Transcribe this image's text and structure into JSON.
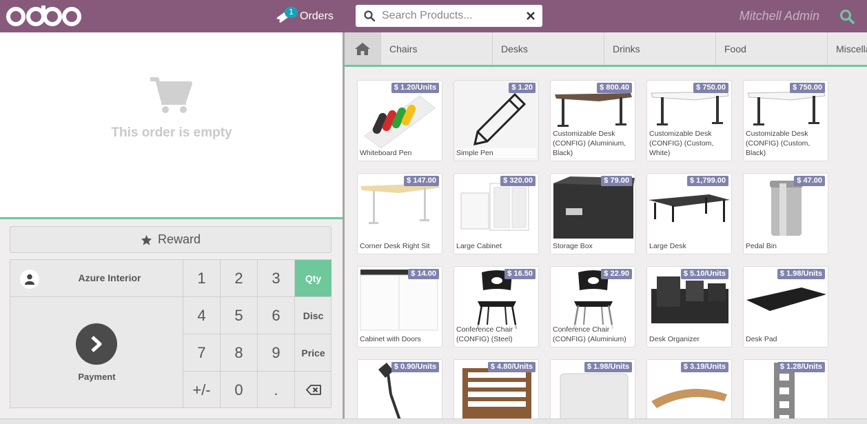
{
  "header": {
    "logo_text": "odoo",
    "orders_badge": "1",
    "orders_label": "Orders",
    "search_placeholder": "Search Products...",
    "search_value": "",
    "username": "Mitchell Admin"
  },
  "order": {
    "empty_text": "This order is empty"
  },
  "actions": {
    "reward_label": "Reward",
    "customer_name": "Azure Interior",
    "payment_label": "Payment"
  },
  "numpad": {
    "keys": [
      "1",
      "2",
      "3",
      "Qty",
      "4",
      "5",
      "6",
      "Disc",
      "7",
      "8",
      "9",
      "Price",
      "+/-",
      "0",
      ".",
      ""
    ],
    "active_mode": "Qty"
  },
  "categories": [
    "Chairs",
    "Desks",
    "Drinks",
    "Food",
    "Miscella"
  ],
  "products": [
    {
      "name": "Whiteboard Pen",
      "price": "$ 1.20/Units",
      "icon": "markers-image"
    },
    {
      "name": "Simple Pen",
      "price": "$ 1.20",
      "icon": "pencil-image"
    },
    {
      "name": "Customizable Desk (CONFIG) (Aluminium, Black)",
      "price": "$ 800.40",
      "icon": "desk-image"
    },
    {
      "name": "Customizable Desk (CONFIG) (Custom, White)",
      "price": "$ 750.00",
      "icon": "desk-image"
    },
    {
      "name": "Customizable Desk (CONFIG) (Custom, Black)",
      "price": "$ 750.00",
      "icon": "desk-image"
    },
    {
      "name": "Corner Desk Right Sit",
      "price": "$ 147.00",
      "icon": "corner-desk-image"
    },
    {
      "name": "Large Cabinet",
      "price": "$ 320.00",
      "icon": "cabinet-image"
    },
    {
      "name": "Storage Box",
      "price": "$ 79.00",
      "icon": "box-image"
    },
    {
      "name": "Large Desk",
      "price": "$ 1,799.00",
      "icon": "large-desk-image"
    },
    {
      "name": "Pedal Bin",
      "price": "$ 47.00",
      "icon": "bin-image"
    },
    {
      "name": "Cabinet with Doors",
      "price": "$ 14.00",
      "icon": "door-cabinet-image"
    },
    {
      "name": "Conference Chair (CONFIG) (Steel)",
      "price": "$ 16.50",
      "icon": "chair-image"
    },
    {
      "name": "Conference Chair (CONFIG) (Aluminium)",
      "price": "$ 22.90",
      "icon": "chair-image"
    },
    {
      "name": "Desk Organizer",
      "price": "$ 5.10/Units",
      "icon": "organizer-image"
    },
    {
      "name": "Desk Pad",
      "price": "$ 1.98/Units",
      "icon": "pad-image"
    },
    {
      "name": "",
      "price": "$ 0.90/Units",
      "icon": "lamp-image"
    },
    {
      "name": "",
      "price": "$ 4.80/Units",
      "icon": "shelf-image"
    },
    {
      "name": "",
      "price": "$ 1.98/Units",
      "icon": "mat-image"
    },
    {
      "name": "",
      "price": "$ 3.19/Units",
      "icon": "stand-image"
    },
    {
      "name": "",
      "price": "$ 1.28/Units",
      "icon": "rack-image"
    }
  ],
  "colors": {
    "header": "#875a7b",
    "accent": "#6ec89b",
    "price_tag": "#7f82ac",
    "search_icon": "#6ec89b"
  }
}
